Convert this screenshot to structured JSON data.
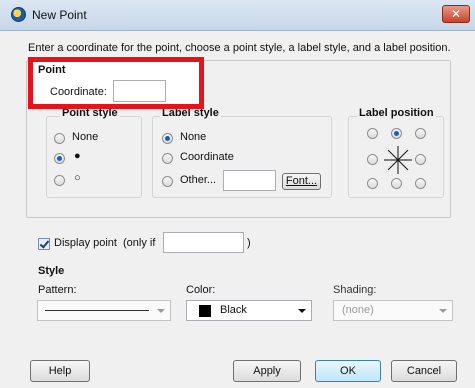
{
  "window": {
    "title": "New Point",
    "close_glyph": "✕"
  },
  "instruction": "Enter a coordinate for the point, choose a point style, a label style, and a label position.",
  "point": {
    "group_title": "Point",
    "coordinate_label": "Coordinate:",
    "coordinate_value": ""
  },
  "point_style": {
    "title": "Point style",
    "options": [
      "None",
      "●",
      "○"
    ],
    "selected": 1
  },
  "label_style": {
    "title": "Label style",
    "options": [
      "None",
      "Coordinate",
      "Other..."
    ],
    "selected": 0,
    "other_value": "",
    "font_button": "Font..."
  },
  "label_position": {
    "title": "Label position",
    "selected": "top-center"
  },
  "display_point": {
    "label": "Display point",
    "only_if": "(only if",
    "close_paren": ")",
    "checked": true,
    "condition_value": ""
  },
  "style": {
    "title": "Style",
    "pattern_label": "Pattern:",
    "color_label": "Color:",
    "color_value": "Black",
    "color_swatch": "#000000",
    "shading_label": "Shading:",
    "shading_value": "(none)"
  },
  "buttons": {
    "help": "Help",
    "apply": "Apply",
    "ok": "OK",
    "cancel": "Cancel"
  },
  "colors": {
    "highlight": "#e8121b",
    "radio_selected": "#1d5fb8",
    "titlebar": "#c7d6e8"
  }
}
